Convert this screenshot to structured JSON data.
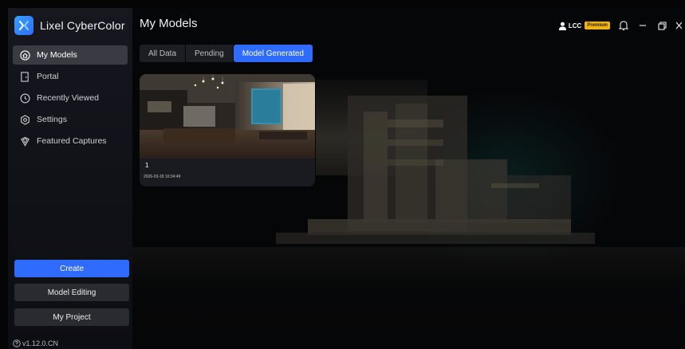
{
  "app": {
    "name": "Lixel CyberColor",
    "version": "v1.12.0.CN"
  },
  "sidebar": {
    "items": [
      {
        "label": "My Models",
        "icon": "home-icon",
        "active": true
      },
      {
        "label": "Portal",
        "icon": "portal-icon",
        "active": false
      },
      {
        "label": "Recently Viewed",
        "icon": "clock-icon",
        "active": false
      },
      {
        "label": "Settings",
        "icon": "gear-icon",
        "active": false
      },
      {
        "label": "Featured Captures",
        "icon": "shield-icon",
        "active": false
      }
    ],
    "create_label": "Create",
    "model_editing_label": "Model Editing",
    "my_project_label": "My Project"
  },
  "header": {
    "title": "My Models",
    "user_name": "LCC",
    "badge": "Premium"
  },
  "tabs": [
    {
      "label": "All Data",
      "active": false
    },
    {
      "label": "Pending",
      "active": false
    },
    {
      "label": "Model Generated",
      "active": true
    }
  ],
  "models": [
    {
      "name": "1",
      "date": "2026-03-18 10:34:49"
    }
  ],
  "colors": {
    "accent": "#2f6bff",
    "badge": "#f5b400",
    "sidebar_bg": "#14151b"
  }
}
